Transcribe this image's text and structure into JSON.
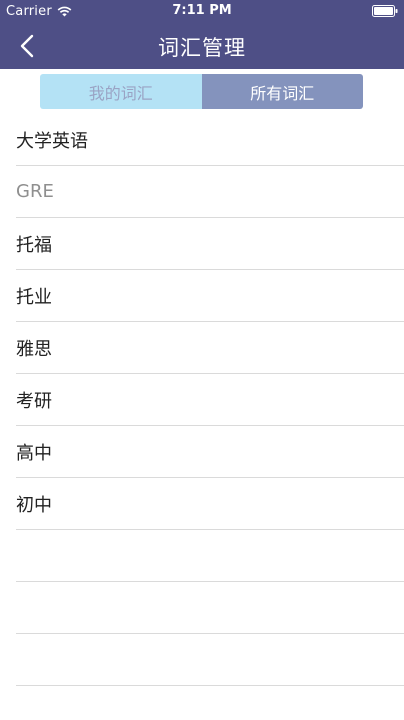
{
  "status_bar": {
    "carrier": "Carrier",
    "time": "7:11 PM"
  },
  "nav": {
    "title": "词汇管理",
    "back_icon": "chevron-left-icon"
  },
  "segment": {
    "mine_label": "我的词汇",
    "all_label": "所有词汇",
    "selected": "all"
  },
  "list": {
    "items": [
      {
        "label": "大学英语"
      },
      {
        "label": "GRE"
      },
      {
        "label": "托福"
      },
      {
        "label": "托业"
      },
      {
        "label": "雅思"
      },
      {
        "label": "考研"
      },
      {
        "label": "高中"
      },
      {
        "label": "初中"
      }
    ]
  },
  "colors": {
    "header": "#4e4f86",
    "segment_unselected": "#b4e2f5",
    "segment_selected": "#8493bd",
    "separator": "#dadada"
  }
}
